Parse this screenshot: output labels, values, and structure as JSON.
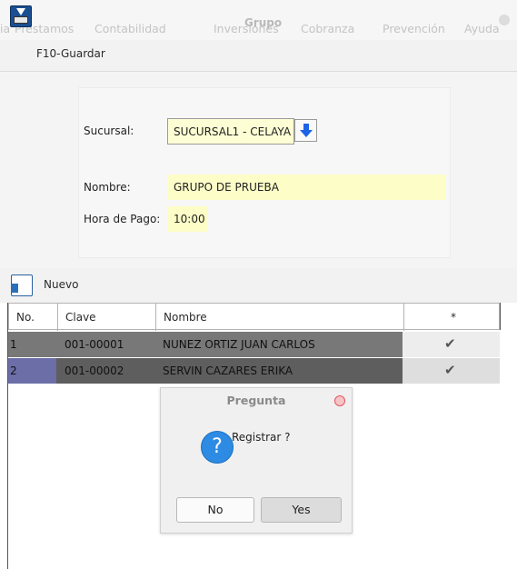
{
  "window": {
    "title": "Grupo",
    "menu": [
      "ia",
      "Préstamos",
      "Contabilidad",
      "Inversiones",
      "Cobranza",
      "Prevención",
      "Ayuda"
    ]
  },
  "toolbar": {
    "save_label": "F10-Guardar",
    "new_label": "Nuevo"
  },
  "form": {
    "sucursal_label": "Sucursal:",
    "sucursal_value": "SUCURSAL1 - CELAYA",
    "nombre_label": "Nombre:",
    "nombre_value": "GRUPO DE PRUEBA",
    "hora_label": "Hora de Pago:",
    "hora_value": "10:00"
  },
  "table": {
    "headers": [
      "No.",
      "Clave",
      "Nombre",
      "*"
    ],
    "rows": [
      {
        "no": "1",
        "clave": "001-00001",
        "nombre": "NUNEZ ORTIZ JUAN CARLOS",
        "mark": "✔"
      },
      {
        "no": "2",
        "clave": "001-00002",
        "nombre": "SERVIN CAZARES ERIKA",
        "mark": "✔"
      }
    ]
  },
  "dialog": {
    "title": "Pregunta",
    "icon": "?",
    "message": "Registrar ?",
    "no_label": "No",
    "yes_label": "Yes"
  }
}
